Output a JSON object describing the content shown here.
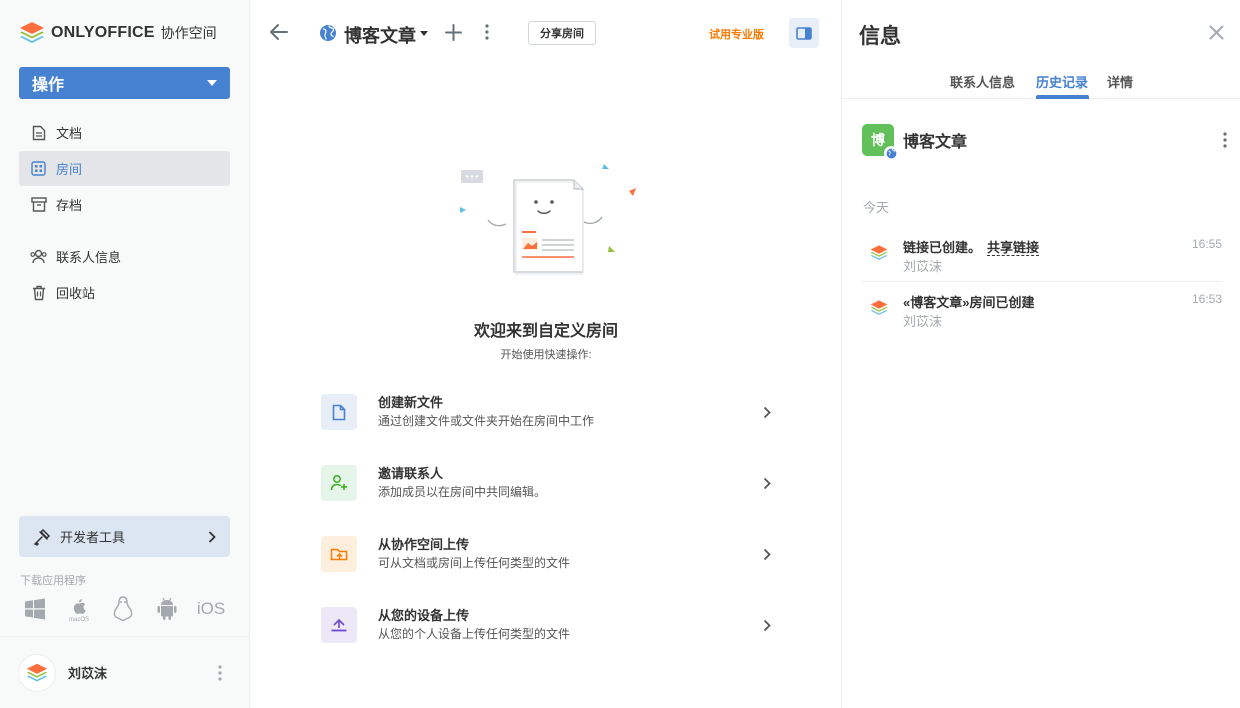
{
  "app": {
    "brand": "ONLYOFFICE",
    "subtitle": "协作空间"
  },
  "sidebar": {
    "action_label": "操作",
    "items": [
      {
        "label": "文档",
        "icon": "document-icon"
      },
      {
        "label": "房间",
        "icon": "rooms-icon",
        "active": true
      },
      {
        "label": "存档",
        "icon": "archive-icon"
      },
      {
        "label": "联系人信息",
        "icon": "contacts-icon"
      },
      {
        "label": "回收站",
        "icon": "trash-icon"
      }
    ],
    "dev_tools_label": "开发者工具",
    "download_label": "下载应用程序",
    "download_apps": [
      "windows",
      "macOS",
      "linux",
      "android",
      "iOS"
    ],
    "user_name": "刘苡沫"
  },
  "header": {
    "room_title": "博客文章",
    "share_label": "分享房间",
    "trial_label": "试用专业版"
  },
  "empty_state": {
    "title": "欢迎来到自定义房间",
    "subtitle": "开始使用快速操作:",
    "actions": [
      {
        "title": "创建新文件",
        "desc": "通过创建文件或文件夹开始在房间中工作",
        "color": "#4781d1",
        "bg": "#e8eef7"
      },
      {
        "title": "邀请联系人",
        "desc": "添加成员以在房间中共同编辑。",
        "color": "#35ad17",
        "bg": "#e6f5ea"
      },
      {
        "title": "从协作空间上传",
        "desc": "可从文档或房间上传任何类型的文件",
        "color": "#ff7a00",
        "bg": "#fdeede"
      },
      {
        "title": "从您的设备上传",
        "desc": "从您的个人设备上传任何类型的文件",
        "color": "#6c49d0",
        "bg": "#ede8f7"
      }
    ]
  },
  "info_panel": {
    "title": "信息",
    "tabs": [
      "联系人信息",
      "历史记录",
      "详情"
    ],
    "active_tab": "历史记录",
    "room_avatar_letter": "博",
    "room_name": "博客文章",
    "day_label": "今天",
    "history": [
      {
        "text": "链接已创建。",
        "link": "共享链接",
        "user": "刘苡沫",
        "time": "16:55"
      },
      {
        "text": "«博客文章»房间已创建",
        "link": "",
        "user": "刘苡沫",
        "time": "16:53"
      }
    ]
  },
  "colors": {
    "accent": "#4781d1",
    "trial": "#ff7a00",
    "room_avatar": "#61c059"
  }
}
